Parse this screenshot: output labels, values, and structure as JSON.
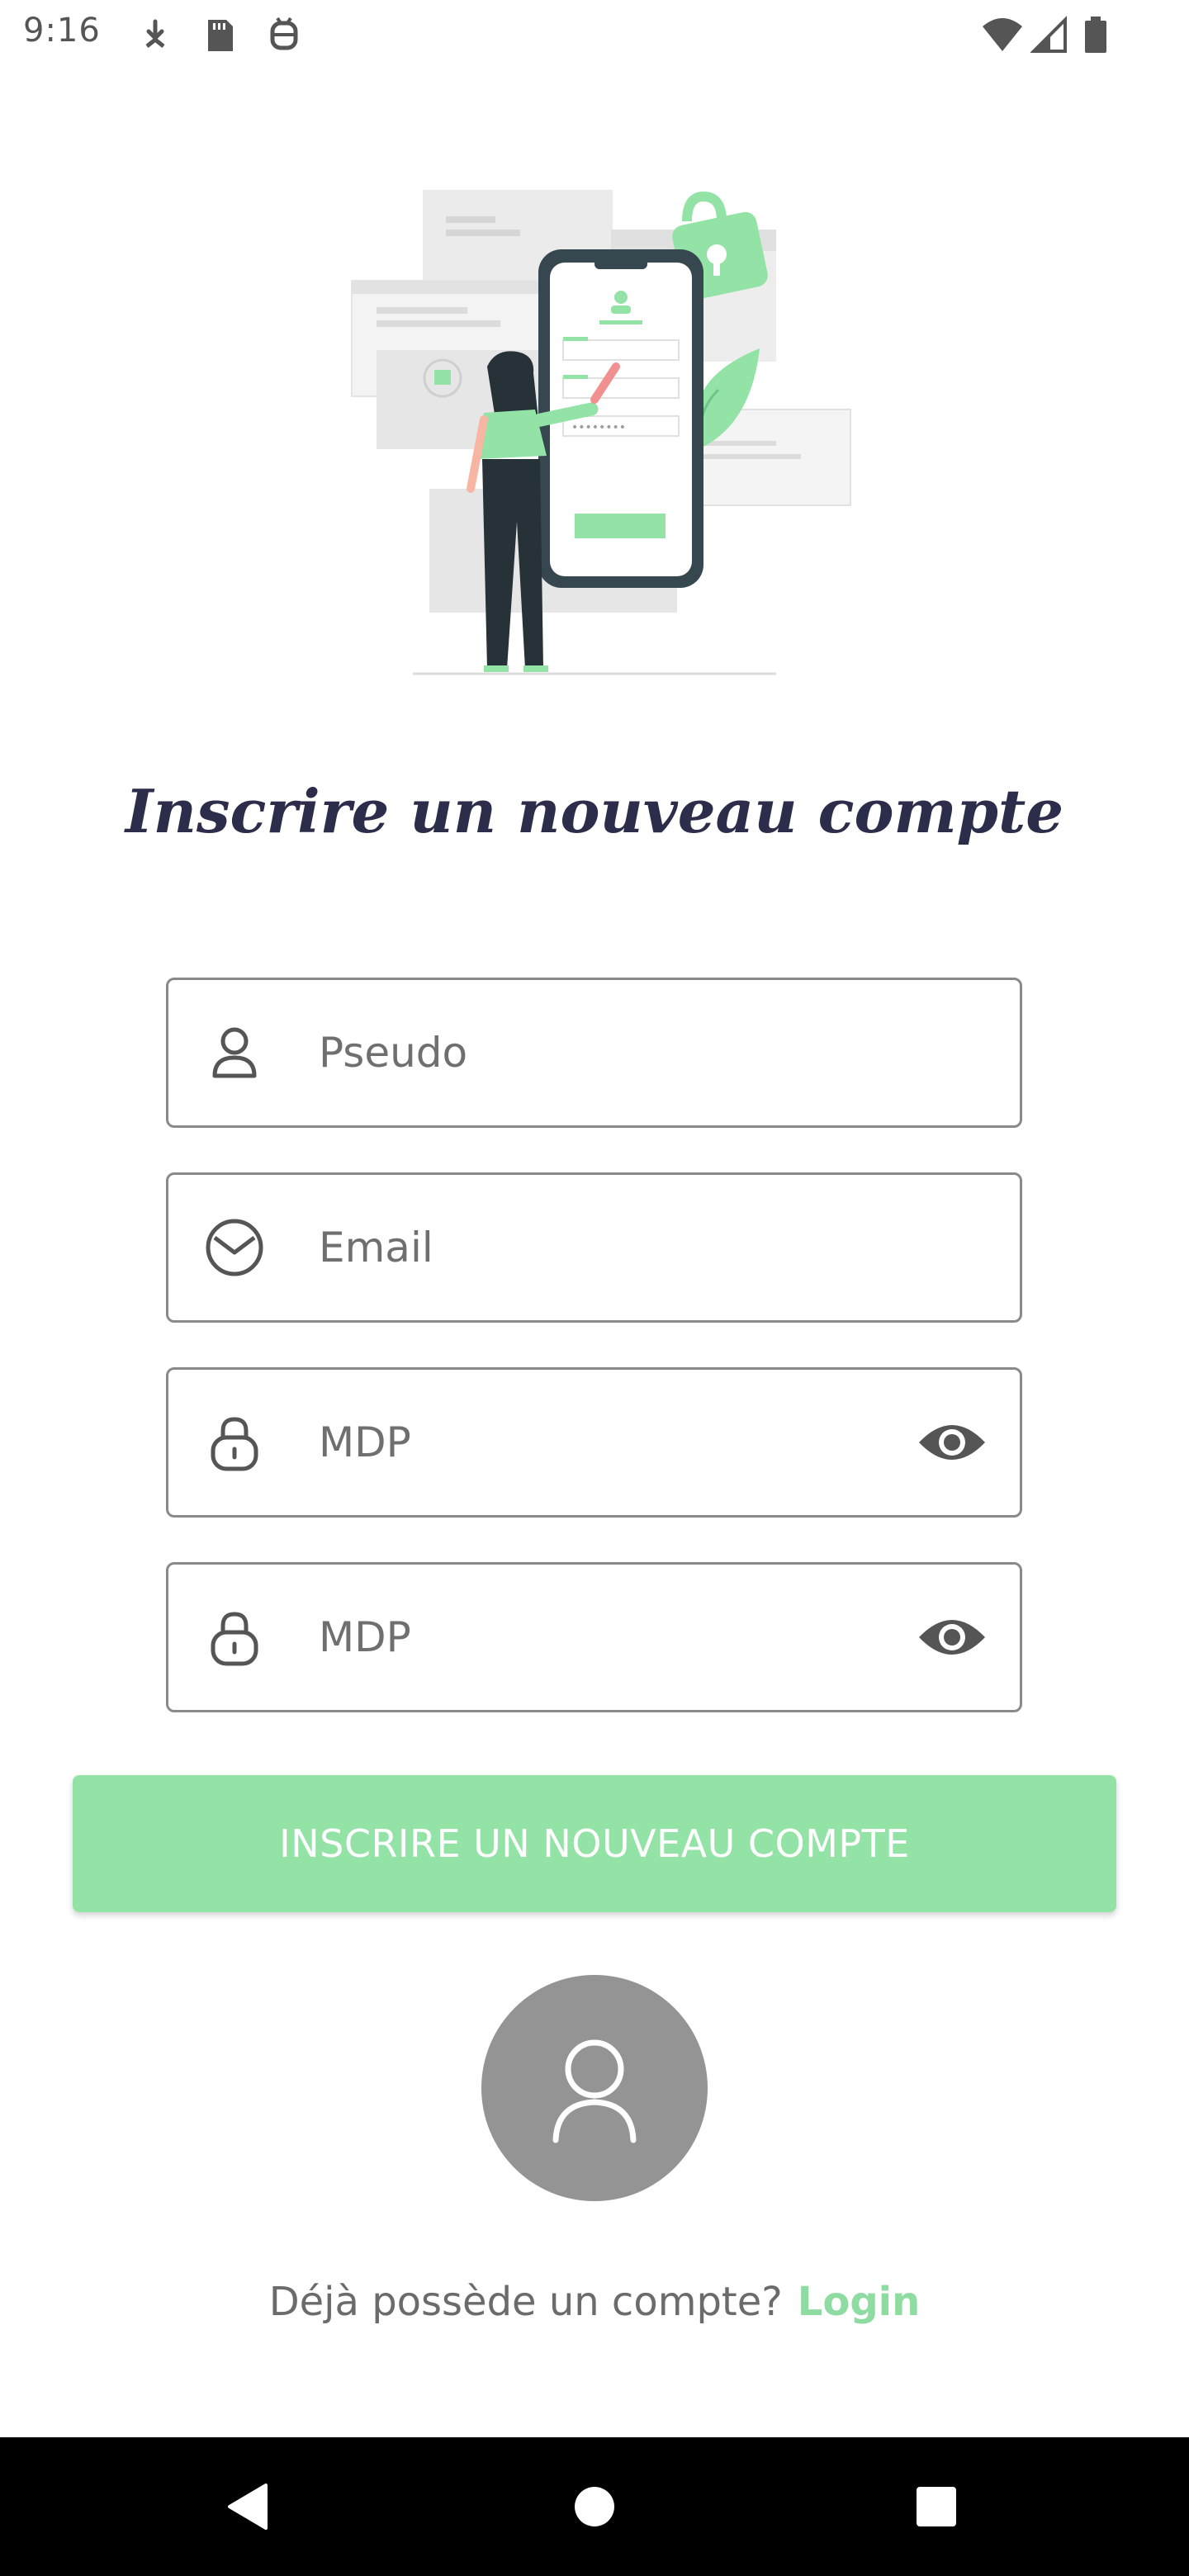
{
  "status_bar": {
    "time": "9:16"
  },
  "title": "Inscrire un nouveau compte",
  "form": {
    "username_placeholder": "Pseudo",
    "email_placeholder": "Email",
    "password_placeholder": "MDP",
    "confirm_password_placeholder": "MDP"
  },
  "register_button_label": "INSCRIRE UN NOUVEAU COMPTE",
  "footer": {
    "prompt": "Déjà possède un compte?",
    "login_link": "Login"
  },
  "colors": {
    "accent_green": "#93e3a7",
    "link_green": "#8fdca3",
    "title_navy": "#2b2d4a",
    "avatar_gray": "#949494"
  },
  "icons": {
    "username": "person-icon",
    "email": "envelope-icon",
    "password": "lock-icon",
    "visibility": "eye-icon",
    "avatar": "person-icon"
  }
}
